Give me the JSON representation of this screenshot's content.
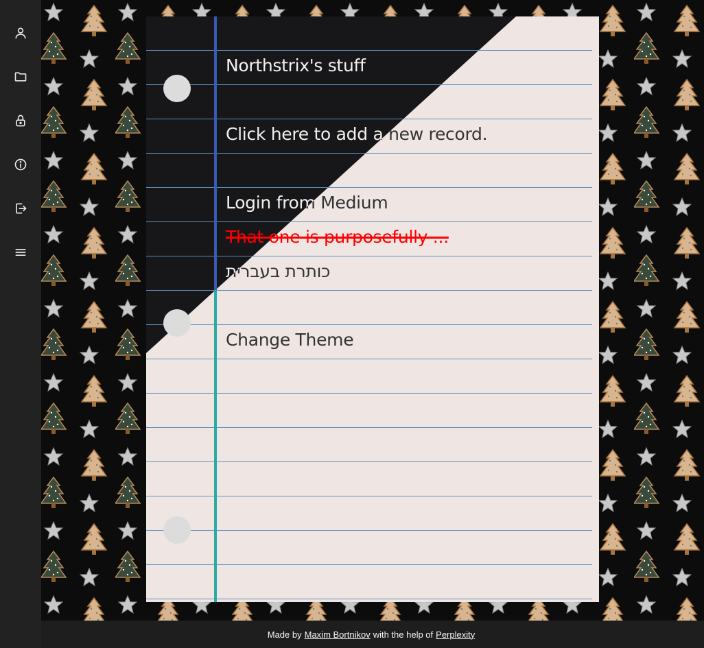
{
  "sidebar": {
    "items": [
      {
        "name": "profile",
        "icon": "user-icon"
      },
      {
        "name": "files",
        "icon": "folder-icon"
      },
      {
        "name": "lock",
        "icon": "lock-icon"
      },
      {
        "name": "info",
        "icon": "info-icon"
      },
      {
        "name": "logout",
        "icon": "logout-icon"
      },
      {
        "name": "menu",
        "icon": "hamburger-menu-icon"
      }
    ]
  },
  "notebook": {
    "title": "Northstrix's stuff",
    "add_record": "Click here to add a new record.",
    "login_link": "Login from Medium",
    "struck_text": "That one is purposefully ...",
    "hebrew_title": "כותרת בעברית",
    "change_theme": "Change Theme"
  },
  "footer": {
    "made_by": "Made by",
    "author": "Maxim Bortnikov",
    "with_help": "with the help of",
    "helper": "Perplexity"
  },
  "colors": {
    "sidebar_bg": "#222222",
    "paper_light": "#efe6e4",
    "paper_dark": "#17171a",
    "rule_line": "#5d8fbe",
    "margin_line_top": "#3a5bb5",
    "margin_line_bottom": "#2aaba5",
    "strike_red": "#ff0000"
  }
}
